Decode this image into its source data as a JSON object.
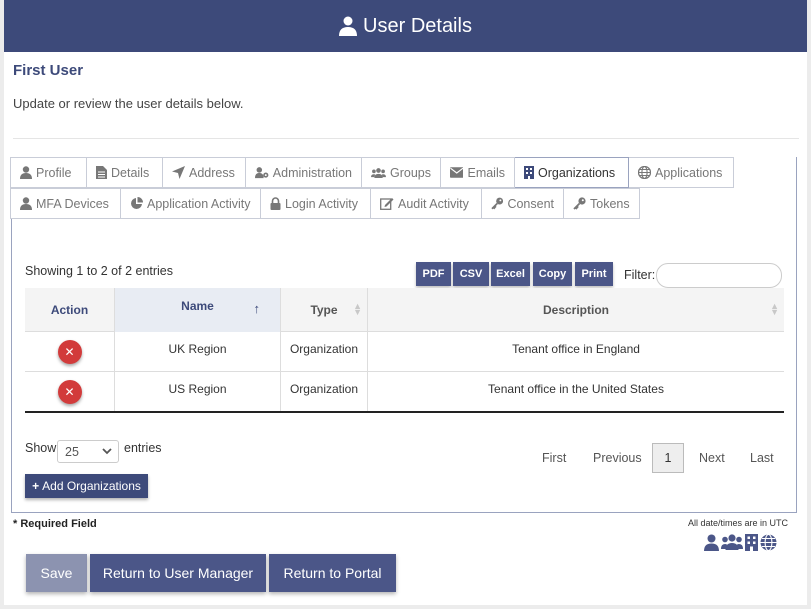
{
  "header": {
    "title": "User Details",
    "icon": "user-icon"
  },
  "user": {
    "name": "First User",
    "intro": "Update or review the user details below."
  },
  "tabs": {
    "row1": [
      {
        "label": "Profile",
        "icon": "user-icon"
      },
      {
        "label": "Details",
        "icon": "document-icon"
      },
      {
        "label": "Address",
        "icon": "location-arrow-icon"
      },
      {
        "label": "Administration",
        "icon": "user-gear-icon"
      },
      {
        "label": "Groups",
        "icon": "users-icon"
      },
      {
        "label": "Emails",
        "icon": "envelope-icon"
      },
      {
        "label": "Organizations",
        "icon": "building-icon",
        "active": true
      },
      {
        "label": "Applications",
        "icon": "globe-icon"
      }
    ],
    "row2": [
      {
        "label": "MFA Devices",
        "icon": "user-icon"
      },
      {
        "label": "Application Activity",
        "icon": "pie-chart-icon"
      },
      {
        "label": "Login Activity",
        "icon": "lock-icon"
      },
      {
        "label": "Audit Activity",
        "icon": "edit-icon"
      },
      {
        "label": "Consent",
        "icon": "key-icon"
      },
      {
        "label": "Tokens",
        "icon": "key-icon"
      }
    ]
  },
  "table": {
    "info": "Showing 1 to 2 of 2 entries",
    "export_buttons": [
      "PDF",
      "CSV",
      "Excel",
      "Copy",
      "Print"
    ],
    "filter_label": "Filter:",
    "filter_value": "",
    "columns": [
      "Action",
      "Name",
      "Type",
      "Description"
    ],
    "sort_indicator": "↑",
    "rows": [
      {
        "name": "UK Region",
        "type": "Organization",
        "description": "Tenant office in England"
      },
      {
        "name": "US Region",
        "type": "Organization",
        "description": "Tenant office in the United States"
      }
    ],
    "length": {
      "show": "Show",
      "value": "25",
      "entries": "entries"
    },
    "pagination": {
      "first": "First",
      "previous": "Previous",
      "current": "1",
      "next": "Next",
      "last": "Last"
    }
  },
  "actions": {
    "add_organizations": "Add Organizations",
    "required_field": "* Required Field",
    "utc_note": "All date/times are in UTC",
    "save": "Save",
    "return_user_manager": "Return to User Manager",
    "return_portal": "Return to Portal"
  },
  "colors": {
    "header": "#3d4a7a",
    "button": "#4b5688",
    "delete": "#d23b3b",
    "save_disabled": "#8c93b0"
  }
}
